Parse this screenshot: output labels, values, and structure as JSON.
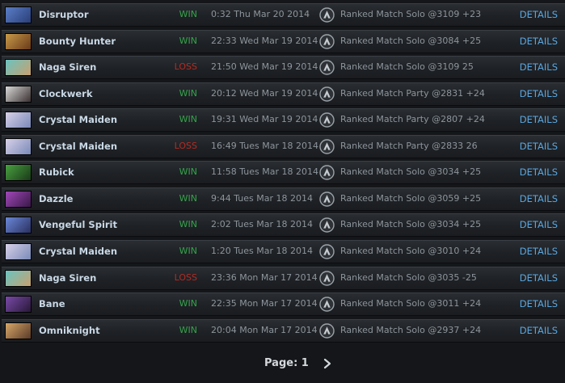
{
  "matches": [
    {
      "hero": "Disruptor",
      "result": "WIN",
      "time": "0:32 Thu Mar 20 2014",
      "match": "Ranked Match Solo @3109 +23",
      "details": "DETAILS",
      "portrait": [
        "#5a7ec8",
        "#2a3e78"
      ]
    },
    {
      "hero": "Bounty Hunter",
      "result": "WIN",
      "time": "22:33 Wed Mar 19 2014",
      "match": "Ranked Match Solo @3084 +25",
      "details": "DETAILS",
      "portrait": [
        "#c89a48",
        "#6a3a1a"
      ]
    },
    {
      "hero": "Naga Siren",
      "result": "LOSS",
      "time": "21:50 Wed Mar 19 2014",
      "match": "Ranked Match Solo @3109 25",
      "details": "DETAILS",
      "portrait": [
        "#6ac4c0",
        "#c8a070"
      ]
    },
    {
      "hero": "Clockwerk",
      "result": "WIN",
      "time": "20:12 Wed Mar 19 2014",
      "match": "Ranked Match Party @2831 +24",
      "details": "DETAILS",
      "portrait": [
        "#d8d8d8",
        "#3a3030"
      ]
    },
    {
      "hero": "Crystal Maiden",
      "result": "WIN",
      "time": "19:31 Wed Mar 19 2014",
      "match": "Ranked Match Party @2807 +24",
      "details": "DETAILS",
      "portrait": [
        "#d8d0e8",
        "#7a8ab8"
      ]
    },
    {
      "hero": "Crystal Maiden",
      "result": "LOSS",
      "time": "16:49 Tues Mar 18 2014",
      "match": "Ranked Match Party @2833 26",
      "details": "DETAILS",
      "portrait": [
        "#d8d0e8",
        "#7a8ab8"
      ]
    },
    {
      "hero": "Rubick",
      "result": "WIN",
      "time": "11:58 Tues Mar 18 2014",
      "match": "Ranked Match Solo @3034 +25",
      "details": "DETAILS",
      "portrait": [
        "#48a040",
        "#1a3a18"
      ]
    },
    {
      "hero": "Dazzle",
      "result": "WIN",
      "time": "9:44 Tues Mar 18 2014",
      "match": "Ranked Match Solo @3059 +25",
      "details": "DETAILS",
      "portrait": [
        "#a048b8",
        "#3a1848"
      ]
    },
    {
      "hero": "Vengeful Spirit",
      "result": "WIN",
      "time": "2:02 Tues Mar 18 2014",
      "match": "Ranked Match Solo @3034 +25",
      "details": "DETAILS",
      "portrait": [
        "#6a88d8",
        "#2a3060"
      ]
    },
    {
      "hero": "Crystal Maiden",
      "result": "WIN",
      "time": "1:20 Tues Mar 18 2014",
      "match": "Ranked Match Solo @3010 +24",
      "details": "DETAILS",
      "portrait": [
        "#d8d0e8",
        "#7a8ab8"
      ]
    },
    {
      "hero": "Naga Siren",
      "result": "LOSS",
      "time": "23:36 Mon Mar 17 2014",
      "match": "Ranked Match Solo @3035 -25",
      "details": "DETAILS",
      "portrait": [
        "#6ac4c0",
        "#c8a070"
      ]
    },
    {
      "hero": "Bane",
      "result": "WIN",
      "time": "22:35 Mon Mar 17 2014",
      "match": "Ranked Match Solo @3011 +24",
      "details": "DETAILS",
      "portrait": [
        "#7a4aa8",
        "#281838"
      ]
    },
    {
      "hero": "Omniknight",
      "result": "WIN",
      "time": "20:04 Mon Mar 17 2014",
      "match": "Ranked Match Solo @2937 +24",
      "details": "DETAILS",
      "portrait": [
        "#d8a868",
        "#5a3a28"
      ]
    }
  ],
  "pagination": {
    "label": "Page: 1",
    "next_icon": "chevron-right-icon"
  },
  "colors": {
    "win": "#34a44a",
    "loss": "#b52a22",
    "hero_name": "#c9d8e6",
    "details_link": "#5aa7e0",
    "muted_text": "#8d959c"
  }
}
